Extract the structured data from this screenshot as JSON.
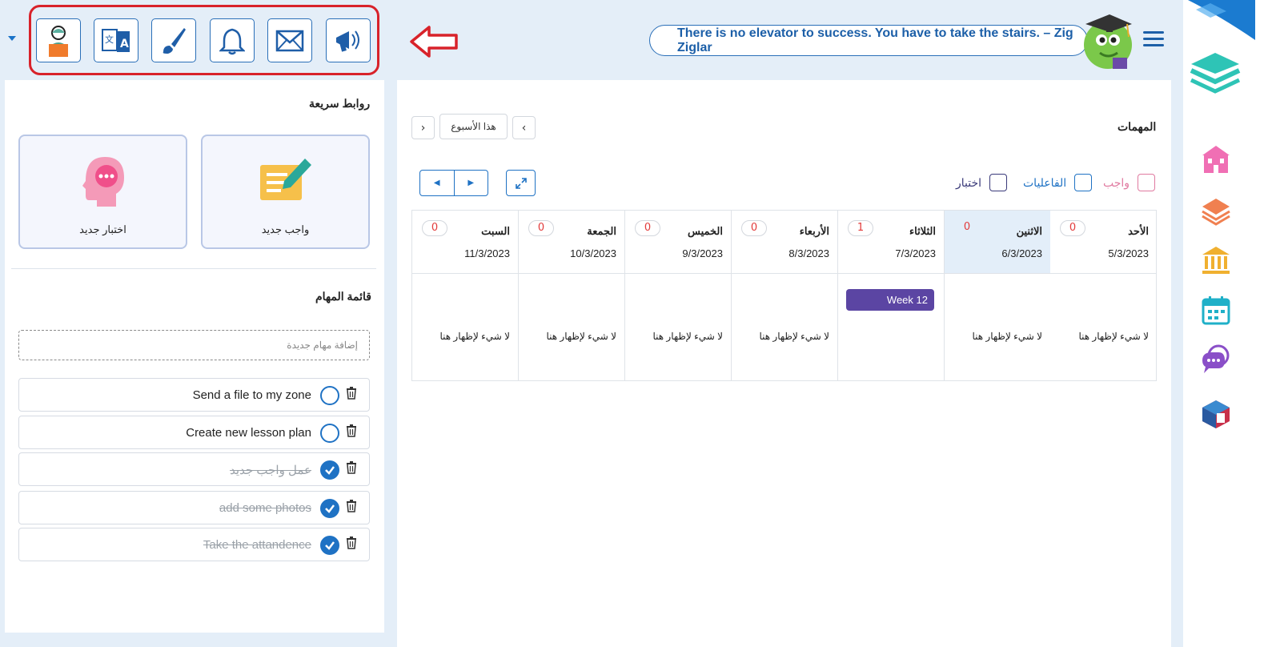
{
  "header": {
    "quote": "There is no elevator to success. You have to take the stairs. – Zig Ziglar",
    "toolbar_icons": [
      "teacher-icon",
      "translate-icon",
      "brush-icon",
      "bell-icon",
      "mail-icon",
      "megaphone-icon"
    ]
  },
  "quick_links": {
    "title": "روابط سريعة",
    "new_homework": "واجب جديد",
    "new_test": "اختبار جديد"
  },
  "todo": {
    "title": "قائمة المهام",
    "add_placeholder": "إضافة مهام جديدة",
    "items": [
      {
        "text": "Send a file to my zone",
        "done": false
      },
      {
        "text": "Create new lesson plan",
        "done": false
      },
      {
        "text": "عمل واجب جديد",
        "done": true
      },
      {
        "text": "add some photos",
        "done": true
      },
      {
        "text": "Take the attandence",
        "done": true
      }
    ]
  },
  "calendar": {
    "title": "المهمات",
    "this_week": "هذا الأسبوع",
    "filters": {
      "homework": "واجب",
      "activities": "الفاعليات",
      "test": "اختبار"
    },
    "filter_colors": {
      "homework": "#e07aa0",
      "activities": "#1f72c4",
      "test": "#3a3a7a"
    },
    "empty_text": "لا شيء لإظهار هنا",
    "days": [
      {
        "name": "الأحد",
        "date": "5/3/2023",
        "count": "0"
      },
      {
        "name": "الاثنين",
        "date": "6/3/2023",
        "count": "0"
      },
      {
        "name": "الثلاثاء",
        "date": "7/3/2023",
        "count": "1",
        "event": "Week 12"
      },
      {
        "name": "الأربعاء",
        "date": "8/3/2023",
        "count": "0"
      },
      {
        "name": "الخميس",
        "date": "9/3/2023",
        "count": "0"
      },
      {
        "name": "الجمعة",
        "date": "10/3/2023",
        "count": "0"
      },
      {
        "name": "السبت",
        "date": "11/3/2023",
        "count": "0"
      }
    ]
  },
  "rail_icons": [
    "school-icon",
    "layers-icon",
    "institution-icon",
    "calendar-icon",
    "chat-bubbles-icon",
    "cube-logo-icon"
  ]
}
